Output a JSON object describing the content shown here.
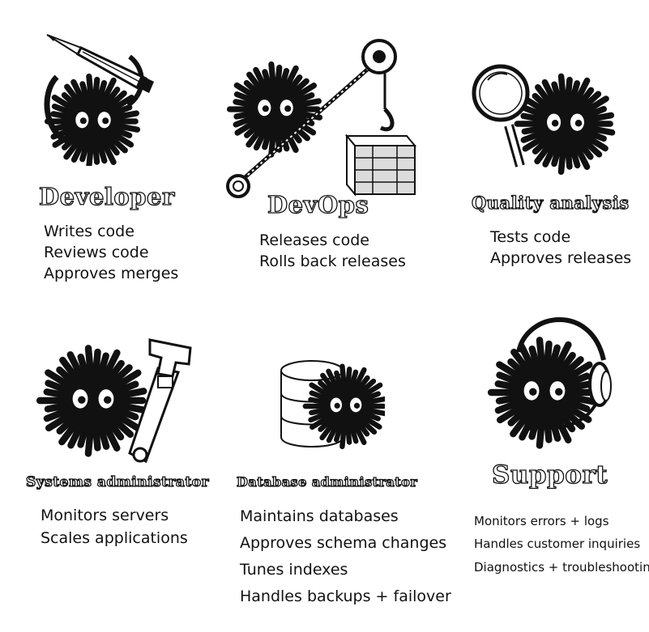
{
  "roles": [
    {
      "title": "Developer",
      "duties": [
        "Writes code",
        "Reviews code",
        "Approves merges"
      ],
      "icon": "pencil-icon"
    },
    {
      "title": "DevOps",
      "duties": [
        "Releases code",
        "Rolls back releases"
      ],
      "icon": "crane-hook-crate-icon"
    },
    {
      "title": "Quality analysis",
      "duties": [
        "Tests code",
        "Approves releases"
      ],
      "icon": "magnifying-glass-icon"
    },
    {
      "title": "Systems administrator",
      "duties": [
        "Monitors servers",
        "Scales applications"
      ],
      "icon": "wrench-icon"
    },
    {
      "title": "Database administrator",
      "duties": [
        "Maintains databases",
        "Approves schema changes",
        "Tunes indexes",
        "Handles backups + failover"
      ],
      "icon": "database-icon"
    },
    {
      "title": "Support",
      "duties": [
        "Monitors errors + logs",
        "Handles customer inquiries",
        "Diagnostics + troubleshooting"
      ],
      "icon": "headset-icon"
    }
  ],
  "colors": {
    "ink": "#111111",
    "paper": "#ffffff",
    "crate": "#dcdcdc"
  }
}
